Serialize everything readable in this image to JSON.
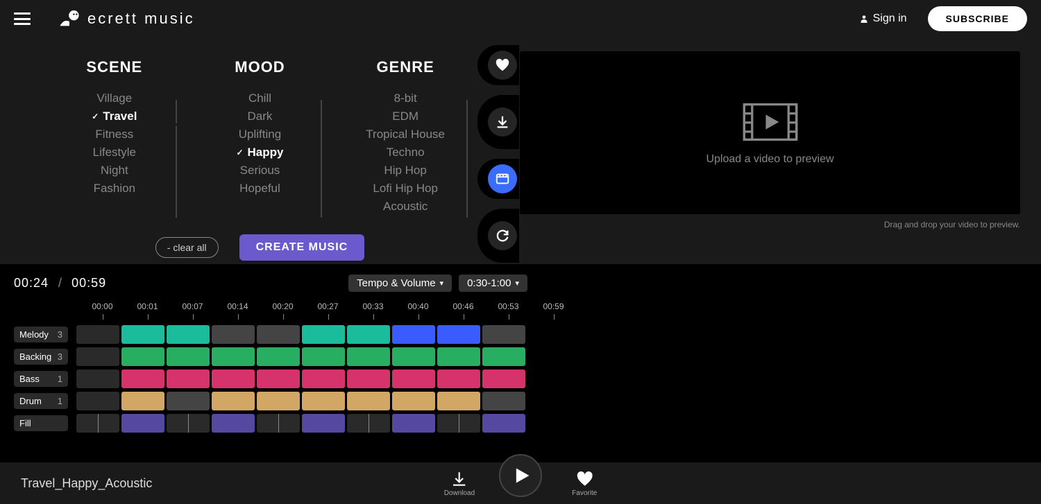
{
  "header": {
    "logo_text": "ecrett music",
    "signin": "Sign in",
    "subscribe": "SUBSCRIBE"
  },
  "categories": {
    "scene": {
      "title": "SCENE",
      "items": [
        "Village",
        "Travel",
        "Fitness",
        "Lifestyle",
        "Night",
        "Fashion"
      ],
      "selected": "Travel"
    },
    "mood": {
      "title": "MOOD",
      "items": [
        "Chill",
        "Dark",
        "Uplifting",
        "Happy",
        "Serious",
        "Hopeful"
      ],
      "selected": "Happy"
    },
    "genre": {
      "title": "GENRE",
      "items": [
        "8-bit",
        "EDM",
        "Tropical House",
        "Techno",
        "Hip Hop",
        "Lofi Hip Hop",
        "Acoustic"
      ],
      "selected": null
    }
  },
  "actions": {
    "clear": "- clear all",
    "create": "CREATE MUSIC"
  },
  "side_buttons": [
    "favorite",
    "download",
    "video",
    "redo"
  ],
  "video_box": {
    "text": "Upload a video to preview",
    "hint": "Drag and drop your video to preview."
  },
  "timeline": {
    "current": "00:24",
    "total": "00:59",
    "tempo_label": "Tempo & Volume",
    "duration_label": "0:30-1:00",
    "ruler": [
      "00:00",
      "00:01",
      "00:07",
      "00:14",
      "00:20",
      "00:27",
      "00:33",
      "00:40",
      "00:46",
      "00:53",
      "00:59"
    ]
  },
  "tracks": [
    {
      "name": "Melody",
      "count": "3"
    },
    {
      "name": "Backing",
      "count": "3"
    },
    {
      "name": "Bass",
      "count": "1"
    },
    {
      "name": "Drum",
      "count": "1"
    },
    {
      "name": "Fill",
      "count": ""
    }
  ],
  "player": {
    "track_name": "Travel_Happy_Acoustic",
    "download": "Download",
    "favorite": "Favorite"
  }
}
